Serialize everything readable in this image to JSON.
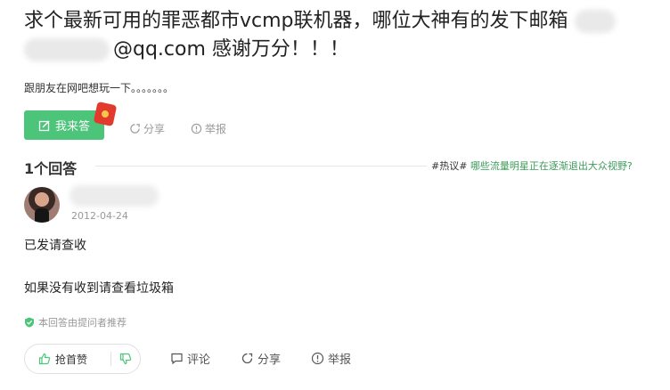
{
  "question": {
    "title_part1": "求个最新可用的罪恶都市vcmp联机器，哪位大神有的发下邮箱",
    "title_part2": "@qq.com 感谢万分！！！",
    "description": "跟朋友在网吧想玩一下。。。。。。。"
  },
  "actions": {
    "answer_label": "我来答",
    "share_label": "分享",
    "report_label": "举报"
  },
  "answers_header": {
    "count_label": "1个回答",
    "hot_tag": "#热议#",
    "hot_topic": "哪些流量明星正在逐渐退出大众视野?"
  },
  "answer": {
    "date": "2012-04-24",
    "line1": "已发请查收",
    "line2": "如果没有收到请查看垃圾箱",
    "recommend_label": "本回答由提问者推荐",
    "like_label": "抢首赞",
    "comment_label": "评论",
    "share_label": "分享",
    "report_label": "举报"
  },
  "colors": {
    "accent_green": "#4cc479",
    "topic_green": "#3c9b5a",
    "muted_text": "#999999"
  },
  "icons": [
    "edit-icon",
    "red-envelope-icon",
    "share-icon",
    "report-icon",
    "shield-check-icon",
    "thumbs-up-icon",
    "thumbs-down-icon",
    "comment-icon"
  ]
}
